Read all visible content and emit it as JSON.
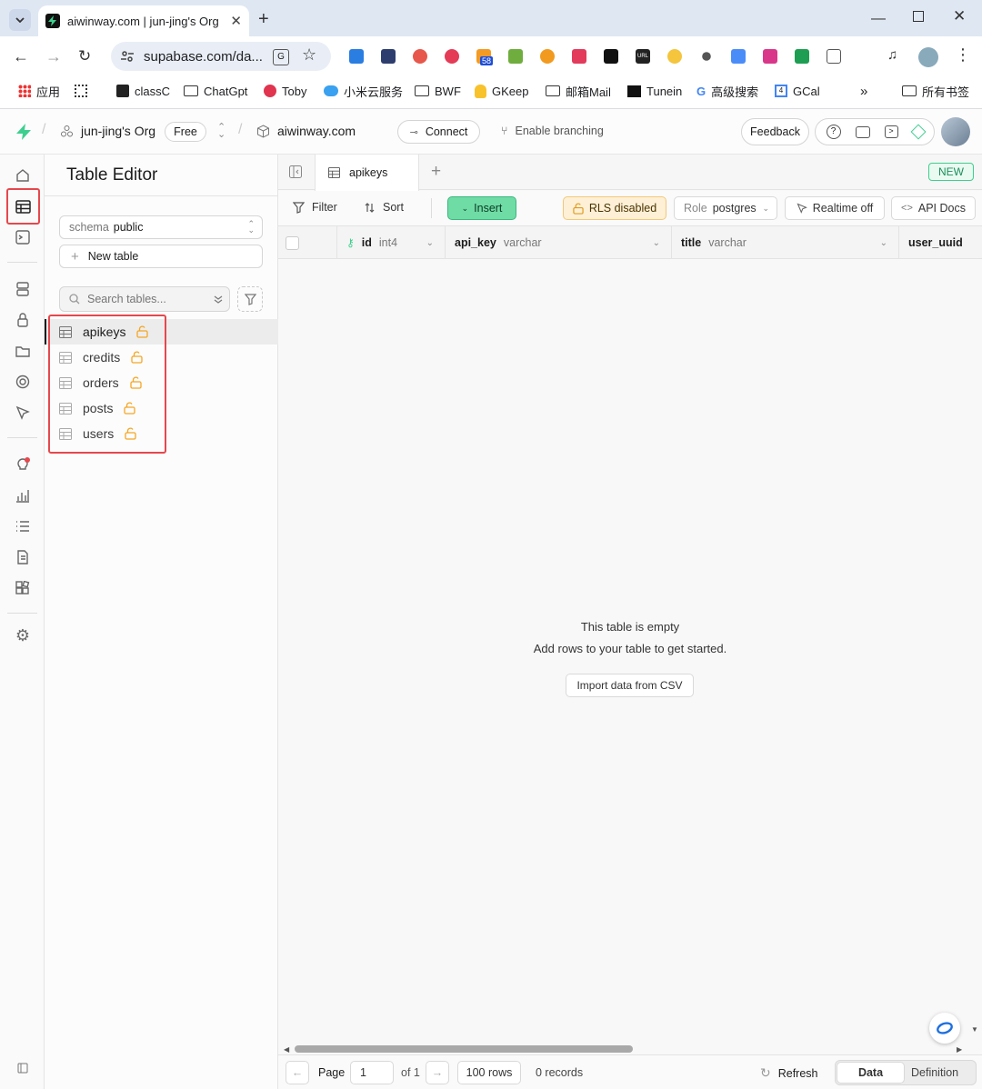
{
  "browser": {
    "tab_title": "aiwinway.com | jun-jing's Org",
    "url": "supabase.com/da...",
    "bookmarks": [
      {
        "icon": "apps-icon",
        "label": "应用"
      },
      {
        "icon": "grid-icon",
        "label": ""
      },
      {
        "icon": "classc-icon",
        "label": "classC"
      },
      {
        "icon": "folder-icon",
        "label": "ChatGpt"
      },
      {
        "icon": "toby-icon",
        "label": "Toby"
      },
      {
        "icon": "cloud-icon",
        "label": "小米云服务"
      },
      {
        "icon": "folder-icon",
        "label": "BWF"
      },
      {
        "icon": "keep-icon",
        "label": "GKeep"
      },
      {
        "icon": "folder-icon",
        "label": "邮箱Mail"
      },
      {
        "icon": "tunein-icon",
        "label": "Tunein"
      },
      {
        "icon": "google-icon",
        "label": "高级搜索"
      },
      {
        "icon": "gcal-icon",
        "label": "GCal"
      }
    ],
    "all_bookmarks": "所有书签",
    "ext_badge": "58"
  },
  "header": {
    "org": "jun-jing's Org",
    "plan": "Free",
    "project": "aiwinway.com",
    "connect": "Connect",
    "branching": "Enable branching",
    "feedback": "Feedback"
  },
  "sidebar": {
    "title": "Table Editor",
    "schema_label": "schema",
    "schema_value": "public",
    "new_table": "New table",
    "search_placeholder": "Search tables...",
    "tables": [
      "apikeys",
      "credits",
      "orders",
      "posts",
      "users"
    ],
    "active": "apikeys"
  },
  "main": {
    "tab": "apikeys",
    "new_badge": "NEW",
    "filter": "Filter",
    "sort": "Sort",
    "insert": "Insert",
    "rls": "RLS disabled",
    "role_label": "Role",
    "role_value": "postgres",
    "realtime": "Realtime off",
    "api_docs": "API Docs",
    "columns": [
      {
        "name": "id",
        "type": "int4"
      },
      {
        "name": "api_key",
        "type": "varchar"
      },
      {
        "name": "title",
        "type": "varchar"
      },
      {
        "name": "user_uuid",
        "type": ""
      }
    ],
    "empty_title": "This table is empty",
    "empty_sub": "Add rows to your table to get started.",
    "import_csv": "Import data from CSV",
    "footer": {
      "page_label": "Page",
      "page_value": "1",
      "of": "of 1",
      "rows": "100 rows",
      "records": "0 records",
      "refresh": "Refresh",
      "data": "Data",
      "definition": "Definition"
    }
  },
  "colors": {
    "accent": "#3ecf8e",
    "highlight": "#e5484d",
    "lock": "#f5a623"
  }
}
